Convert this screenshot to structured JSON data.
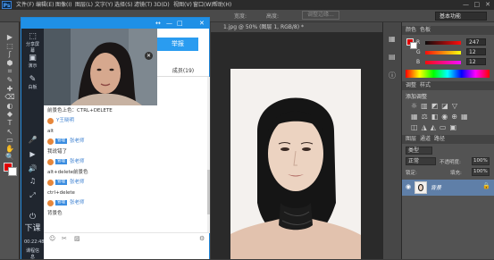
{
  "photoshop": {
    "logo": "Ps",
    "menu": [
      "文件(F)",
      "编辑(E)",
      "图像(I)",
      "图层(L)",
      "文字(Y)",
      "选择(S)",
      "滤镜(T)",
      "3D(D)",
      "视图(V)",
      "窗口(W)",
      "帮助(H)"
    ],
    "window_controls": [
      "—",
      "□",
      "✕"
    ],
    "options": {
      "width_label": "宽度:",
      "height_label": "高度:",
      "adjust_edge": "调整边缘...",
      "workspace": "基本功能"
    },
    "document_tab": "1.jpg @ 50% (图层 1, RGB/8) *",
    "tools": [
      "▶",
      "⬚",
      "ʃ",
      "⬢",
      "⌗",
      "✎",
      "✚",
      "⌫",
      "◐",
      "◆",
      "T",
      "↖",
      "▭",
      "✋",
      "🔍"
    ],
    "colors": {
      "foreground": "#e00000",
      "background": "#ffffff",
      "accent": "#1f90e6"
    }
  },
  "panels": {
    "color_tabs": [
      "颜色",
      "色板"
    ],
    "sliders": [
      {
        "label": "R",
        "value": "247"
      },
      {
        "label": "G",
        "value": "12"
      },
      {
        "label": "B",
        "value": "12"
      }
    ],
    "adjustments_tabs": [
      "调整",
      "样式"
    ],
    "adjustments_title": "添加调整",
    "layers_tabs": [
      "图层",
      "通道",
      "路径"
    ],
    "kind_label": "类型",
    "blend_mode": "正常",
    "opacity_label": "不透明度:",
    "opacity_value": "100%",
    "lock_label": "锁定:",
    "fill_label": "填充:",
    "fill_value": "100%",
    "layer_name": "背景"
  },
  "chat": {
    "title_icons": [
      "↔",
      "—",
      "□",
      "✕"
    ],
    "blue_button": "举报",
    "members_tab": "成员(19)",
    "side_buttons": [
      {
        "icon": "⬚",
        "label": "分享屏幕"
      },
      {
        "icon": "▣",
        "label": "演示"
      },
      {
        "icon": "✎",
        "label": "白板"
      }
    ],
    "side_bottom": {
      "stop": "下课",
      "time": "00:22:48",
      "info": "课程信息"
    },
    "messages": [
      {
        "type": "text",
        "text": "前景色上色：CTRL+DELETE"
      },
      {
        "type": "sender",
        "badge": "",
        "name": "Y王晓明"
      },
      {
        "type": "text",
        "text": "alt"
      },
      {
        "type": "sender",
        "badge": "管理",
        "name": "张老师"
      },
      {
        "type": "text",
        "text": "我说错了"
      },
      {
        "type": "sender",
        "badge": "管理",
        "name": "张老师"
      },
      {
        "type": "text",
        "text": "alt+delete前景色"
      },
      {
        "type": "sender",
        "badge": "管理",
        "name": "张老师"
      },
      {
        "type": "text",
        "text": "ctrl+delete"
      },
      {
        "type": "sender",
        "badge": "管理",
        "name": "张老师"
      },
      {
        "type": "text",
        "text": "背景色"
      }
    ],
    "input_tools": [
      "☺",
      "✂",
      "▨",
      "⚙"
    ]
  }
}
